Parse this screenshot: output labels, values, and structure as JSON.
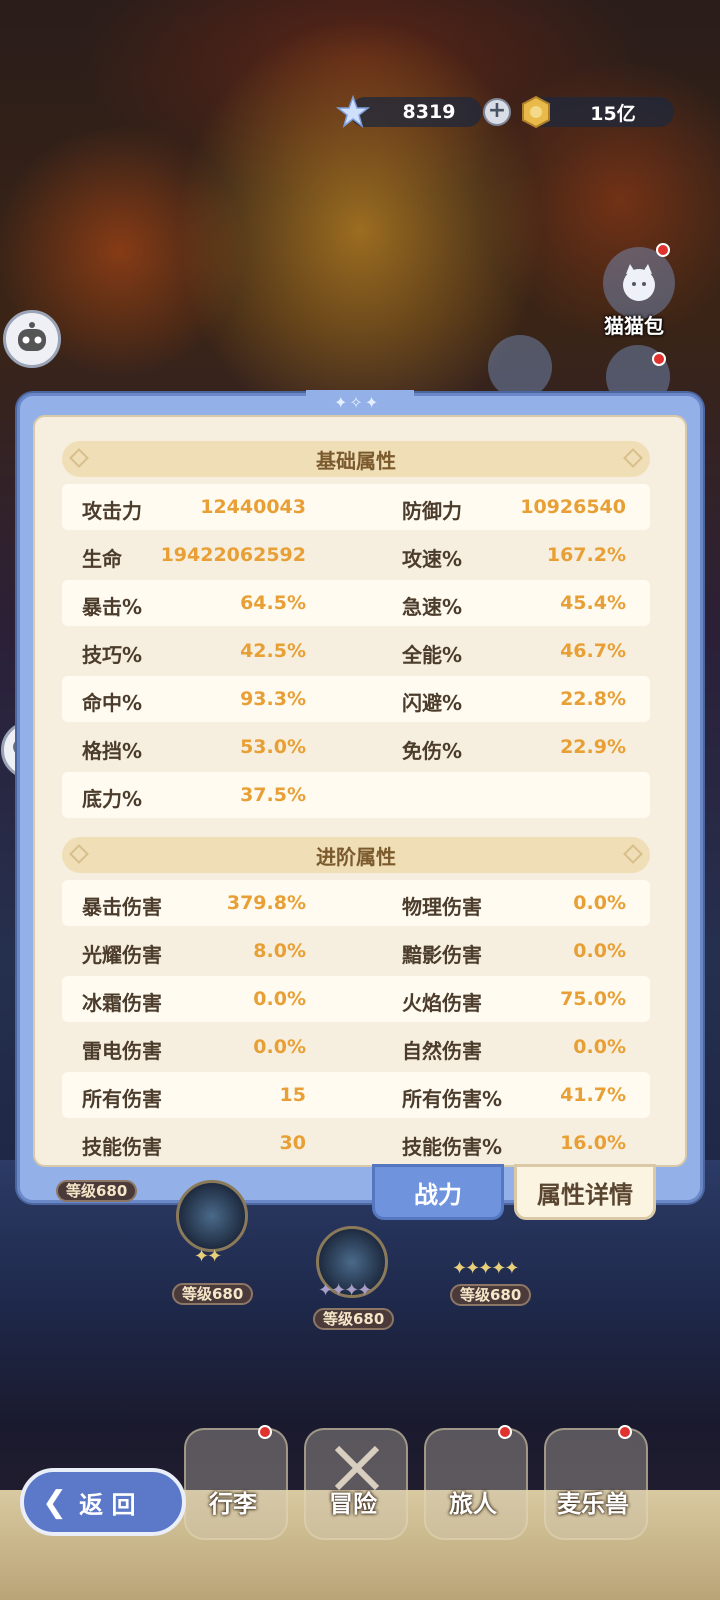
{
  "currency": {
    "gems": "8319",
    "gold": "15亿"
  },
  "side_menu": {
    "cat_bag_label": "猫猫包"
  },
  "basic_section": {
    "title": "基础属性",
    "rows": [
      {
        "l_label": "攻击力",
        "l_value": "12440043",
        "r_label": "防御力",
        "r_value": "10926540"
      },
      {
        "l_label": "生命",
        "l_value": "19422062592",
        "r_label": "攻速%",
        "r_value": "167.2%"
      },
      {
        "l_label": "暴击%",
        "l_value": "64.5%",
        "r_label": "急速%",
        "r_value": "45.4%"
      },
      {
        "l_label": "技巧%",
        "l_value": "42.5%",
        "r_label": "全能%",
        "r_value": "46.7%"
      },
      {
        "l_label": "命中%",
        "l_value": "93.3%",
        "r_label": "闪避%",
        "r_value": "22.8%"
      },
      {
        "l_label": "格挡%",
        "l_value": "53.0%",
        "r_label": "免伤%",
        "r_value": "22.9%"
      },
      {
        "l_label": "底力%",
        "l_value": "37.5%",
        "r_label": "",
        "r_value": ""
      }
    ]
  },
  "advanced_section": {
    "title": "进阶属性",
    "rows": [
      {
        "l_label": "暴击伤害",
        "l_value": "379.8%",
        "r_label": "物理伤害",
        "r_value": "0.0%"
      },
      {
        "l_label": "光耀伤害",
        "l_value": "8.0%",
        "r_label": "黯影伤害",
        "r_value": "0.0%"
      },
      {
        "l_label": "冰霜伤害",
        "l_value": "0.0%",
        "r_label": "火焰伤害",
        "r_value": "75.0%"
      },
      {
        "l_label": "雷电伤害",
        "l_value": "0.0%",
        "r_label": "自然伤害",
        "r_value": "0.0%"
      },
      {
        "l_label": "所有伤害",
        "l_value": "15",
        "r_label": "所有伤害%",
        "r_value": "41.7%"
      },
      {
        "l_label": "技能伤害",
        "l_value": "30",
        "r_label": "技能伤害%",
        "r_value": "16.0%"
      }
    ]
  },
  "tabs": {
    "combat": "战力",
    "details": "属性详情"
  },
  "pets": {
    "level_1": "等级680",
    "level_2": "等级680",
    "level_3": "等级680",
    "level_4": "等级680"
  },
  "nav": {
    "back": "返 回",
    "luggage": "行李",
    "adventure": "冒险",
    "traveler": "旅人",
    "beast": "麦乐兽"
  },
  "colors": {
    "value_orange": "#e8a036",
    "panel_blue": "#93b0e8",
    "panel_cream": "#f6efdf",
    "header_tan": "#f0dfb6"
  }
}
